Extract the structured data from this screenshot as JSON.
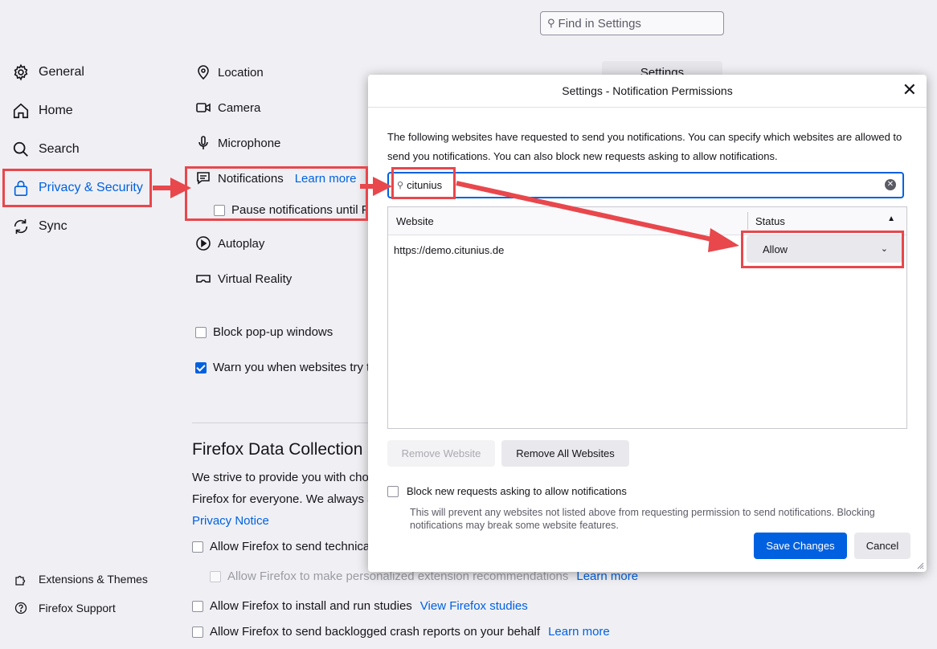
{
  "search": {
    "placeholder": "Find in Settings"
  },
  "sidebar": {
    "items": [
      {
        "label": "General",
        "icon": "gear-icon"
      },
      {
        "label": "Home",
        "icon": "home-icon"
      },
      {
        "label": "Search",
        "icon": "search-icon"
      },
      {
        "label": "Privacy & Security",
        "icon": "lock-icon",
        "selected": true
      },
      {
        "label": "Sync",
        "icon": "sync-icon"
      }
    ],
    "footer": [
      {
        "label": "Extensions & Themes",
        "icon": "puzzle-icon"
      },
      {
        "label": "Firefox Support",
        "icon": "help-icon"
      }
    ]
  },
  "permissions": {
    "location": "Location",
    "camera": "Camera",
    "microphone": "Microphone",
    "notifications": "Notifications",
    "notifications_learn_more": "Learn more",
    "pause_notifications": "Pause notifications until Fi",
    "autoplay": "Autoplay",
    "virtual_reality": "Virtual Reality",
    "settings_button": "Settings",
    "block_popups": "Block pop-up windows",
    "warn_addons": "Warn you when websites try t",
    "block_popups_checked": false,
    "warn_addons_checked": true
  },
  "data_collection": {
    "heading": "Firefox Data Collection a",
    "line1": "We strive to provide you with cho",
    "line2": "Firefox for everyone. We always a",
    "privacy_notice": "Privacy Notice",
    "technical": "Allow Firefox to send technica",
    "extension_recs": "Allow Firefox to make personalized extension recommendations",
    "extension_recs_learn_more": "Learn more",
    "studies": "Allow Firefox to install and run studies",
    "studies_link": "View Firefox studies",
    "crash_reports": "Allow Firefox to send backlogged crash reports on your behalf",
    "crash_learn_more": "Learn more"
  },
  "dialog": {
    "title": "Settings - Notification Permissions",
    "description": "The following websites have requested to send you notifications. You can specify which websites are allowed to send you notifications. You can also block new requests asking to allow notifications.",
    "search_value": "citunius",
    "columns": {
      "website": "Website",
      "status": "Status"
    },
    "rows": [
      {
        "website": "https://demo.citunius.de",
        "status": "Allow"
      }
    ],
    "remove_website": "Remove Website",
    "remove_all": "Remove All Websites",
    "block_new": "Block new requests asking to allow notifications",
    "block_new_desc": "This will prevent any websites not listed above from requesting permission to send notifications. Blocking notifications may break some website features.",
    "save": "Save Changes",
    "cancel": "Cancel"
  },
  "colors": {
    "accent": "#0061e0",
    "annotation": "#e8474c",
    "background": "#f0f0f4"
  }
}
